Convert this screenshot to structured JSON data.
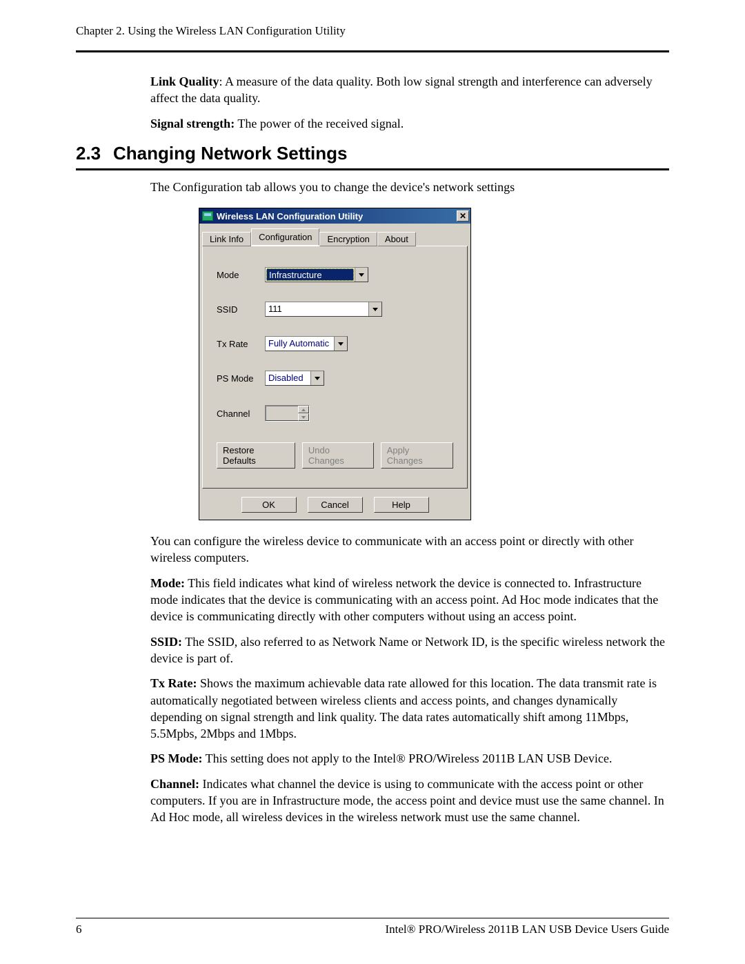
{
  "header": {
    "chapter_line": "Chapter 2. Using the Wireless LAN Configuration Utility"
  },
  "intro": {
    "link_quality_label": "Link Quality",
    "link_quality_text": ": A measure of the data quality. Both low signal strength and interference can adversely affect the data quality.",
    "signal_strength_label": "Signal strength:",
    "signal_strength_text": " The power of the received signal."
  },
  "section": {
    "number": "2.3",
    "title": "Changing Network Settings",
    "lead": "The Configuration tab allows you to change the device's network settings"
  },
  "dialog": {
    "title": "Wireless LAN Configuration Utility",
    "close_glyph": "✕",
    "tabs": [
      "Link Info",
      "Configuration",
      "Encryption",
      "About"
    ],
    "active_tab_index": 1,
    "fields": {
      "mode": {
        "label": "Mode",
        "value": "Infrastructure"
      },
      "ssid": {
        "label": "SSID",
        "value": "111"
      },
      "txrate": {
        "label": "Tx Rate",
        "value": "Fully Automatic"
      },
      "psmode": {
        "label": "PS Mode",
        "value": "Disabled"
      },
      "channel": {
        "label": "Channel",
        "value": ""
      }
    },
    "panel_buttons": {
      "restore": "Restore Defaults",
      "undo": "Undo Changes",
      "apply": "Apply Changes"
    },
    "bottom_buttons": {
      "ok": "OK",
      "cancel": "Cancel",
      "help": "Help"
    }
  },
  "body_paras": {
    "after_dialog": "You can configure the wireless device to communicate with an access point or directly with other wireless computers.",
    "mode_label": "Mode:",
    "mode_text": "  This field indicates what kind of wireless network the device is connected to. Infrastructure mode indicates that the device is communicating with an access point. Ad Hoc mode indicates that the device is communicating directly with other computers without using an access point.",
    "ssid_label": "SSID:",
    "ssid_text": " The SSID, also referred to as Network Name or Network ID, is the specific wireless network the device is part of.",
    "tx_label": "Tx Rate:",
    "tx_text": " Shows the maximum achievable data rate allowed for this location. The data transmit rate is automatically negotiated between wireless clients and access points, and changes dynamically depending on signal strength and link quality. The data rates automatically shift among 11Mbps, 5.5Mpbs, 2Mbps and 1Mbps.",
    "ps_label": "PS Mode:",
    "ps_text": " This setting does not apply to the Intel® PRO/Wireless 2011B LAN USB Device.",
    "ch_label": "Channel:",
    "ch_text": " Indicates what channel the device is using to communicate with the access point or other computers. If you are in Infrastructure mode, the access point and device must use the same channel. In Ad Hoc mode, all wireless devices in the wireless network must use the same channel."
  },
  "footer": {
    "page": "6",
    "doc_title": "Intel® PRO/Wireless 2011B LAN USB Device Users Guide"
  }
}
